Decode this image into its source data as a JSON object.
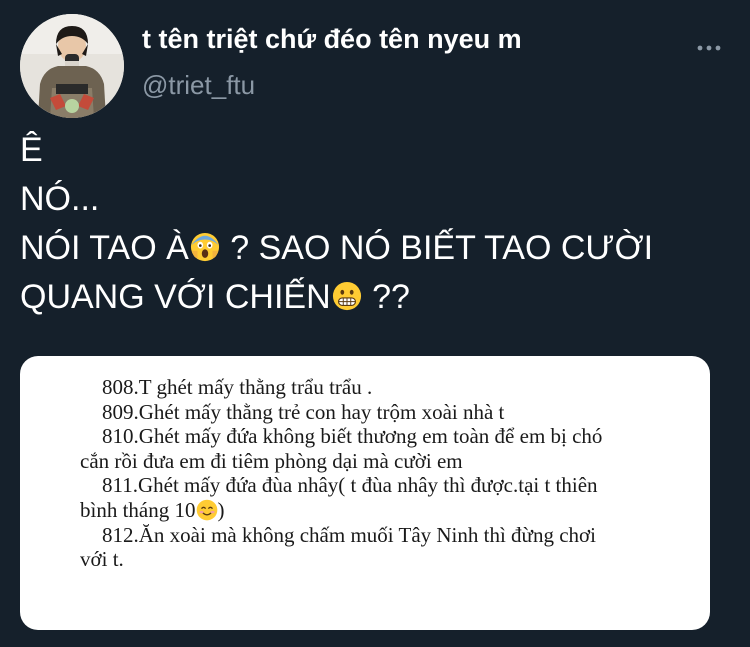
{
  "header": {
    "display_name": "t tên triệt chứ đéo tên nyeu m",
    "handle": "@triet_ftu",
    "avatar_icon": "avatar-photo",
    "more_icon": "more-horizontal-icon"
  },
  "tweet": {
    "line1": "Ê",
    "line2": "NÓ...",
    "line3_a": "NÓI TAO À",
    "line3_b": " ? SAO NÓ BIẾT TAO CƯỜI",
    "line4_a": "QUANG VỚI CHIẾN",
    "line4_b": " ??",
    "emoji_1": "face-screaming-in-fear",
    "emoji_2": "grimacing-face"
  },
  "media": {
    "lines": [
      "808.T ghét mấy thằng trẩu  trẩu .",
      "809.Ghét mấy thằng trẻ con hay trộm xoài nhà t",
      "810.Ghét mấy đứa không biết thương em toàn để em bị chó",
      "cắn rồi đưa em đi tiêm phòng dại mà cười em",
      "811.Ghét mấy đứa đùa nhây( t đùa nhây thì được.tại t thiên",
      "bình tháng 10",
      ")",
      "812.Ăn xoài mà không chấm muối Tây Ninh thì đừng chơi",
      "với t."
    ],
    "emoji": "smiling-face-with-smiling-eyes"
  },
  "colors": {
    "background": "#15202b",
    "text": "#ffffff",
    "secondary_text": "#8b98a5",
    "media_background": "#ffffff"
  }
}
